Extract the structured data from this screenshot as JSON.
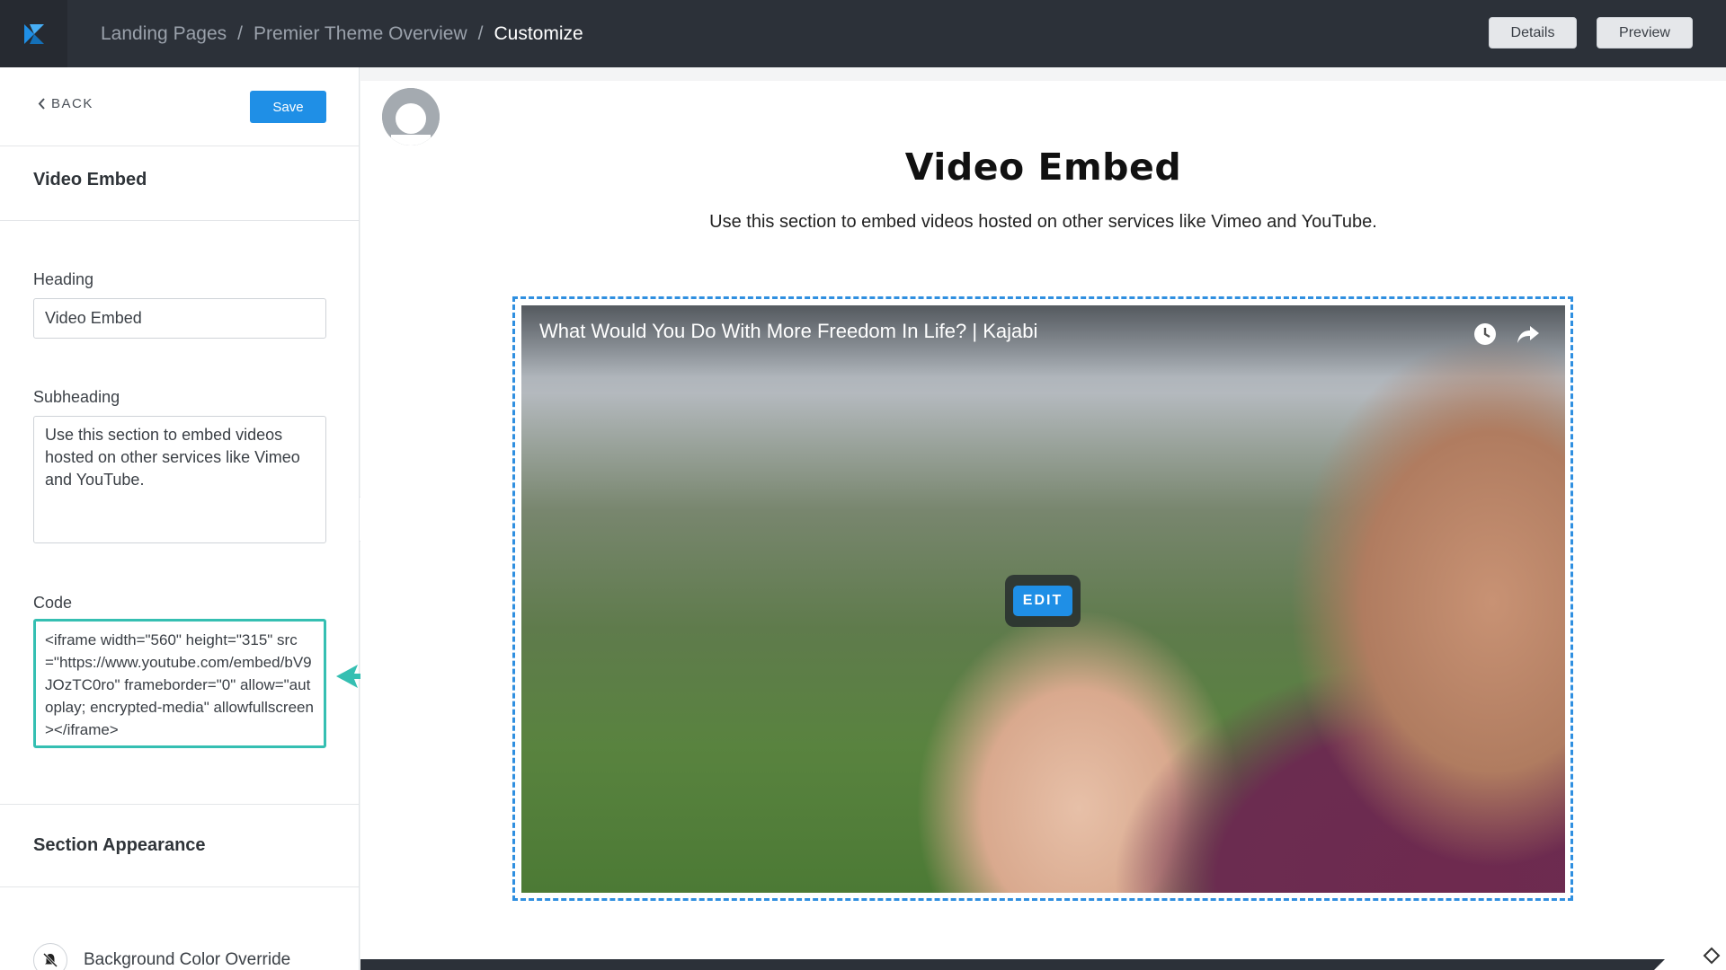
{
  "topbar": {
    "logo": "kajabi-logo-icon",
    "breadcrumb": [
      "Landing Pages",
      "Premier Theme Overview",
      "Customize"
    ],
    "separator": "/",
    "details_label": "Details",
    "preview_label": "Preview"
  },
  "sidebar": {
    "back_label": "BACK",
    "save_label": "Save",
    "section_title": "Video Embed",
    "heading_label": "Heading",
    "heading_value": "Video Embed",
    "subheading_label": "Subheading",
    "subheading_value": "Use this section to embed videos hosted on other services like Vimeo and YouTube.",
    "code_label": "Code",
    "code_value": "<iframe width=\"560\" height=\"315\" src=\"https://www.youtube.com/embed/bV9JOzTC0ro\" frameborder=\"0\" allow=\"autoplay; encrypted-media\" allowfullscreen></iframe>",
    "appearance_title": "Section Appearance",
    "bg_override_label": "Background Color Override"
  },
  "preview": {
    "heading": "Video Embed",
    "subheading": "Use this section to embed videos hosted on other services like Vimeo and YouTube.",
    "video_title": "What Would You Do With More Freedom In Life? | Kajabi",
    "edit_label": "EDIT"
  },
  "colors": {
    "accent": "#1f8fe6",
    "highlight": "#35bfb2",
    "topbar": "#2c3139"
  }
}
